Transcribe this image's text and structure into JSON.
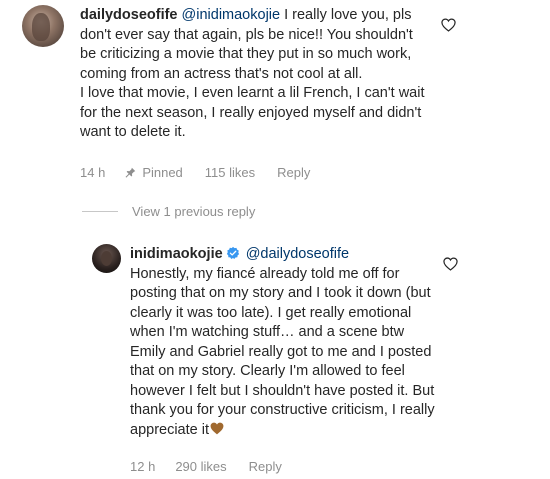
{
  "comment1": {
    "username": "dailydoseofife",
    "mention": "@inidimaokojie",
    "body": " I really love you, pls don't ever say that again, pls be nice!! You shouldn't be criticizing a movie that they put in so much work, coming from an actress that's not cool at all.",
    "body2": "I love that movie, I even learnt a lil French, I can't wait for the next season, I really enjoyed myself and didn't want to delete it.",
    "time": "14 h",
    "pinned": "Pinned",
    "likes": "115 likes",
    "reply": "Reply"
  },
  "view_previous": "View 1 previous reply",
  "comment2": {
    "username": "inidimaokojie",
    "mention": "@dailydoseofife",
    "body": "Honestly, my fiancé already told me off for posting that on my story and I took it down (but clearly it was too late). I get really emotional when I'm watching stuff… and a scene btw Emily and Gabriel really got to me and I posted that on my story. Clearly I'm allowed to feel however I felt but I shouldn't have posted it. But thank you for your constructive criticism, I really appreciate it",
    "emoji": "brown-heart-emoji",
    "time": "12 h",
    "likes": "290 likes",
    "reply": "Reply"
  },
  "colors": {
    "text": "#262626",
    "secondary": "#8e8e8e",
    "mention": "#00376b",
    "verified": "#3897f0",
    "emoji_heart": "#a0692f"
  }
}
